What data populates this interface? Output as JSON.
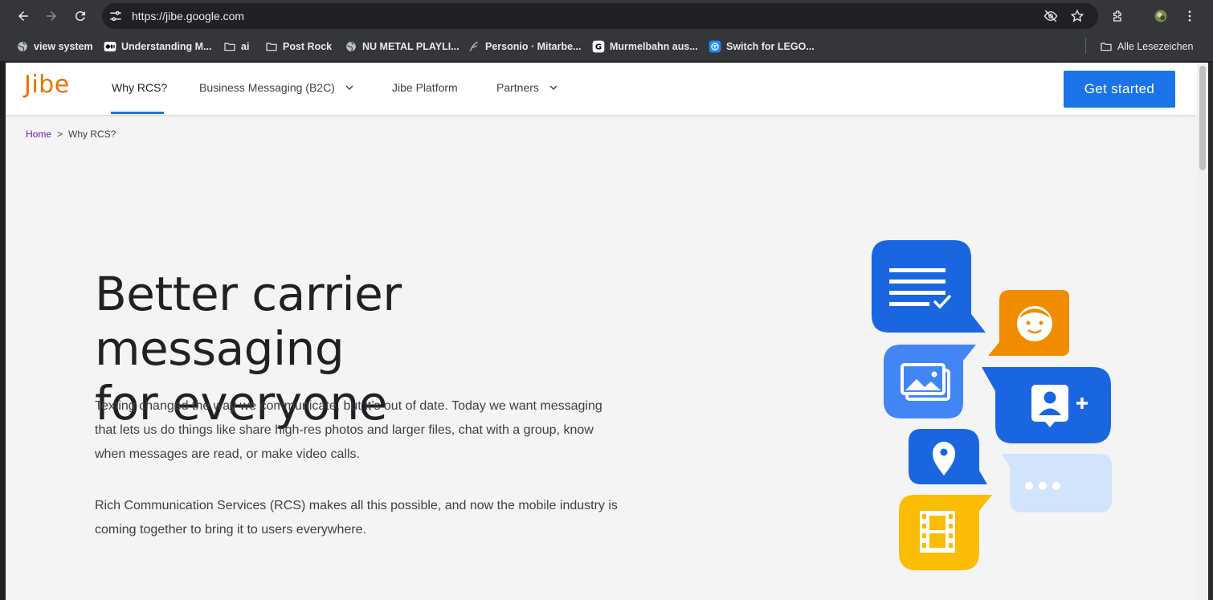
{
  "browser": {
    "url": "https://jibe.google.com",
    "bookmarks": [
      {
        "label": "view system",
        "icon": "globe-icon"
      },
      {
        "label": "Understanding M...",
        "icon": "medium-icon"
      },
      {
        "label": "ai",
        "icon": "folder-icon"
      },
      {
        "label": "Post Rock",
        "icon": "folder-icon"
      },
      {
        "label": "NU METAL PLAYLI...",
        "icon": "globe-icon"
      },
      {
        "label": "Personio · Mitarbe...",
        "icon": "personio-icon"
      },
      {
        "label": "Murmelbahn aus...",
        "icon": "g-icon"
      },
      {
        "label": "Switch for LEGO...",
        "icon": "switch-icon"
      }
    ],
    "all_bookmarks": "Alle Lesezeichen"
  },
  "site": {
    "logo": "Jibe",
    "nav": [
      {
        "label": "Why RCS?",
        "active": true,
        "dropdown": false
      },
      {
        "label": "Business Messaging (B2C)",
        "active": false,
        "dropdown": true
      },
      {
        "label": "Jibe Platform",
        "active": false,
        "dropdown": false
      },
      {
        "label": "Partners",
        "active": false,
        "dropdown": true
      }
    ],
    "cta": "Get started",
    "accent_color": "#1a73e8",
    "logo_color": "#e37400"
  },
  "breadcrumb": {
    "home": "Home",
    "separator": ">",
    "current": "Why RCS?"
  },
  "hero": {
    "title_line1": "Better carrier messaging",
    "title_line2": "for everyone",
    "paragraph1": "Texting changed the way we communicate, but it’s out of date. Today we want messaging that lets us do things like share high-res photos and larger files, chat with a group, know when messages are read, or make video calls.",
    "paragraph2": "Rich Communication Services (RCS) makes all this possible, and now the mobile industry is coming together to bring it to users everywhere."
  }
}
